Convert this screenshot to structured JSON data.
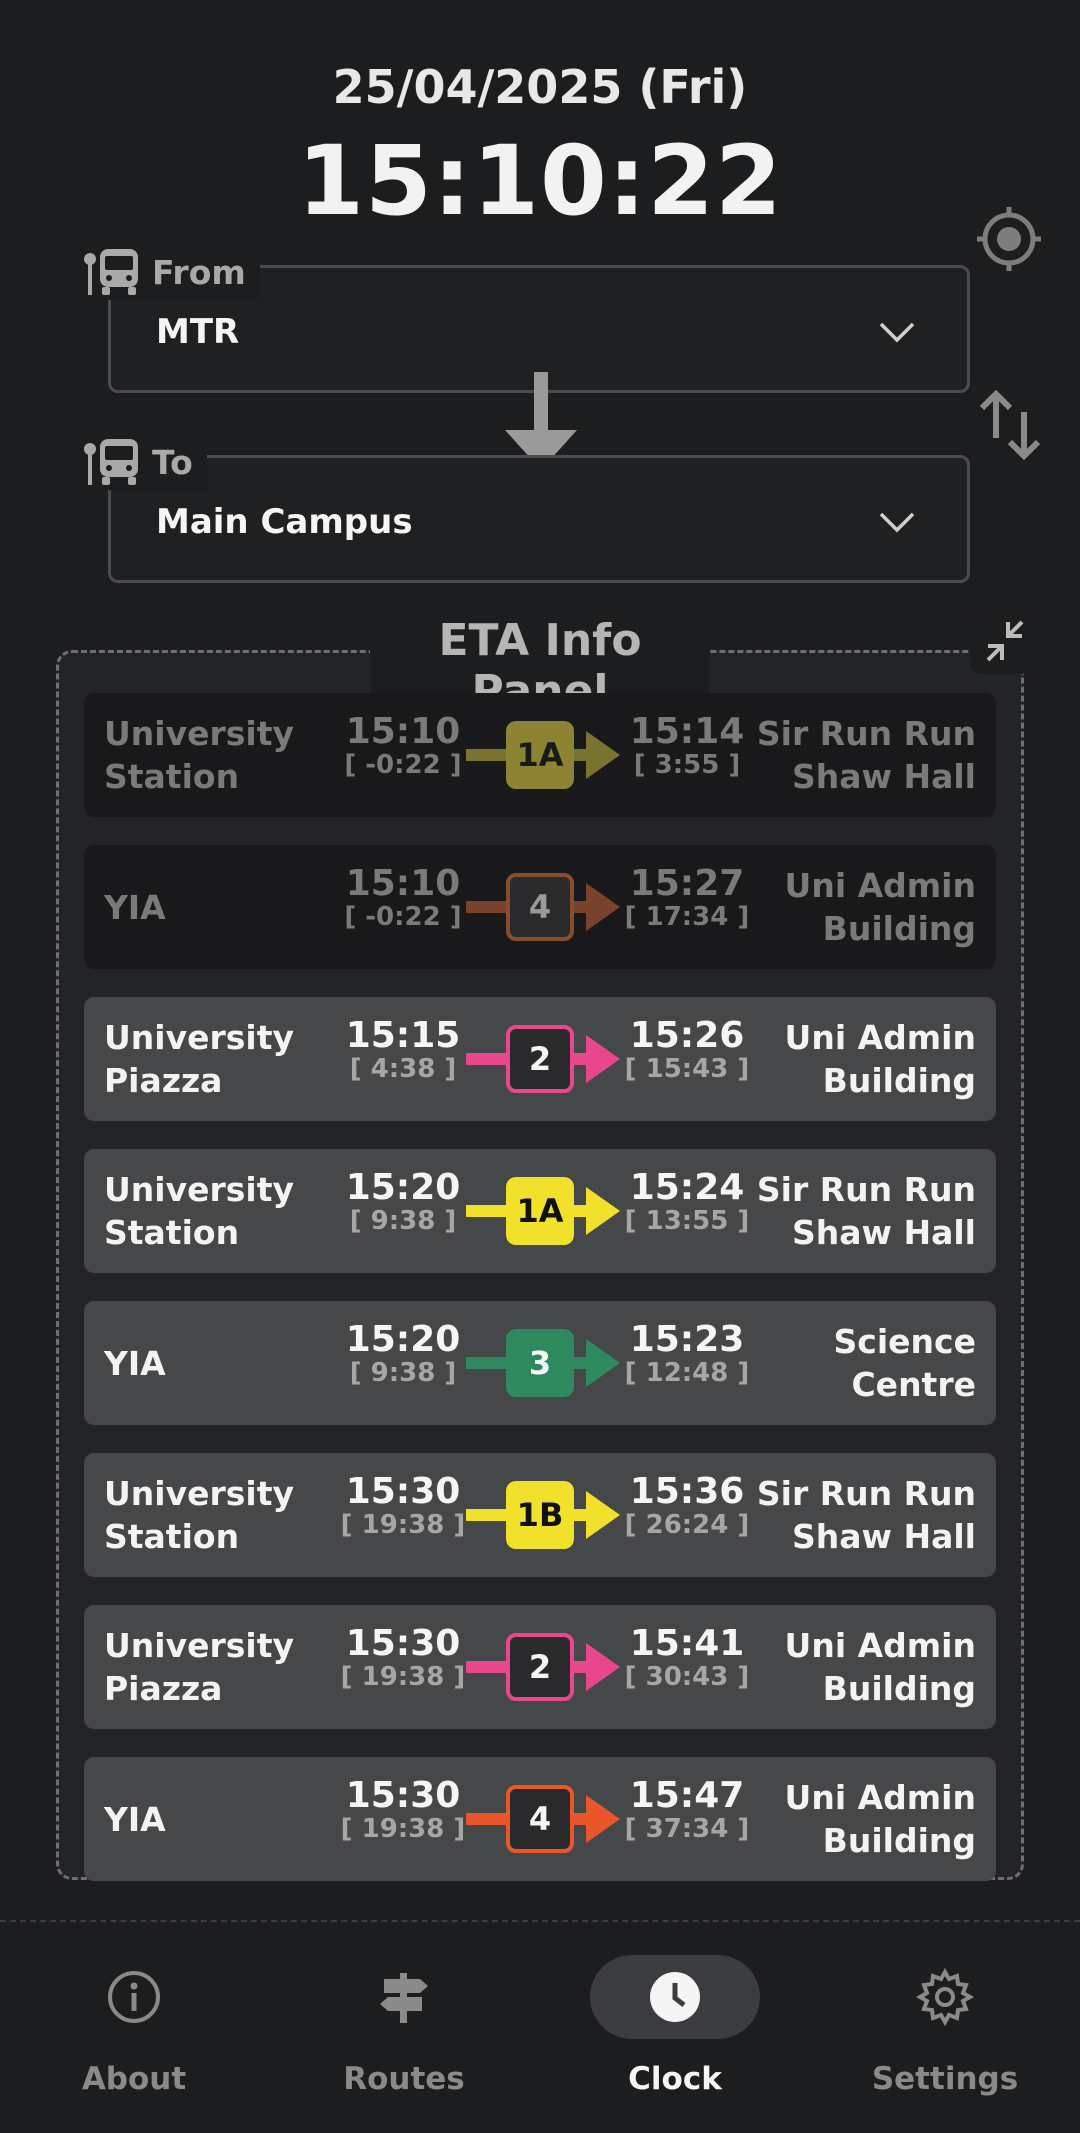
{
  "header": {
    "date": "25/04/2025 (Fri)",
    "time": "15:10:22"
  },
  "icons": {
    "locate": "crosshair-icon",
    "swap": "swap-arrows-icon",
    "bus_stop": "bus-stop-icon",
    "collapse": "collapse-icon",
    "chevron": "chevron-down-icon"
  },
  "from": {
    "label": "From",
    "value": "MTR"
  },
  "to": {
    "label": "To",
    "value": "Main Campus"
  },
  "panel": {
    "title": "ETA Info Panel"
  },
  "rows": [
    {
      "from": "University Station",
      "dep": "15:10",
      "dep_cd": "[ -0:22 ]",
      "route": "1A",
      "arr": "15:14",
      "arr_cd": "[ 3:55 ]",
      "to": "Sir Run Run Shaw Hall",
      "past": true,
      "color": "#8c8433",
      "text_color": "#1a1a1a",
      "style": "filled"
    },
    {
      "from": "YIA",
      "dep": "15:10",
      "dep_cd": "[ -0:22 ]",
      "route": "4",
      "arr": "15:27",
      "arr_cd": "[ 17:34 ]",
      "to": "Uni Admin Building",
      "past": true,
      "color": "#8a4a2e",
      "text_color": "#9a9a9a",
      "style": "outline"
    },
    {
      "from": "University Piazza",
      "dep": "15:15",
      "dep_cd": "[ 4:38 ]",
      "route": "2",
      "arr": "15:26",
      "arr_cd": "[ 15:43 ]",
      "to": "Uni Admin Building",
      "past": false,
      "color": "#e8478d",
      "text_color": "#f5f5f5",
      "style": "outline"
    },
    {
      "from": "University Station",
      "dep": "15:20",
      "dep_cd": "[ 9:38 ]",
      "route": "1A",
      "arr": "15:24",
      "arr_cd": "[ 13:55 ]",
      "to": "Sir Run Run Shaw Hall",
      "past": false,
      "color": "#f2e12a",
      "text_color": "#111111",
      "style": "filled"
    },
    {
      "from": "YIA",
      "dep": "15:20",
      "dep_cd": "[ 9:38 ]",
      "route": "3",
      "arr": "15:23",
      "arr_cd": "[ 12:48 ]",
      "to": "Science Centre",
      "past": false,
      "color": "#2e8a5e",
      "text_color": "#f5f5f5",
      "style": "filled"
    },
    {
      "from": "University Station",
      "dep": "15:30",
      "dep_cd": "[ 19:38 ]",
      "route": "1B",
      "arr": "15:36",
      "arr_cd": "[ 26:24 ]",
      "to": "Sir Run Run Shaw Hall",
      "past": false,
      "color": "#f2e12a",
      "text_color": "#111111",
      "style": "filled"
    },
    {
      "from": "University Piazza",
      "dep": "15:30",
      "dep_cd": "[ 19:38 ]",
      "route": "2",
      "arr": "15:41",
      "arr_cd": "[ 30:43 ]",
      "to": "Uni Admin Building",
      "past": false,
      "color": "#e8478d",
      "text_color": "#f5f5f5",
      "style": "outline"
    },
    {
      "from": "YIA",
      "dep": "15:30",
      "dep_cd": "[ 19:38 ]",
      "route": "4",
      "arr": "15:47",
      "arr_cd": "[ 37:34 ]",
      "to": "Uni Admin Building",
      "past": false,
      "color": "#e8562a",
      "text_color": "#f5f5f5",
      "style": "outline"
    }
  ],
  "nav": [
    {
      "label": "About",
      "icon": "info-icon",
      "active": false
    },
    {
      "label": "Routes",
      "icon": "signpost-icon",
      "active": false
    },
    {
      "label": "Clock",
      "icon": "clock-icon",
      "active": true
    },
    {
      "label": "Settings",
      "icon": "gear-icon",
      "active": false
    }
  ]
}
